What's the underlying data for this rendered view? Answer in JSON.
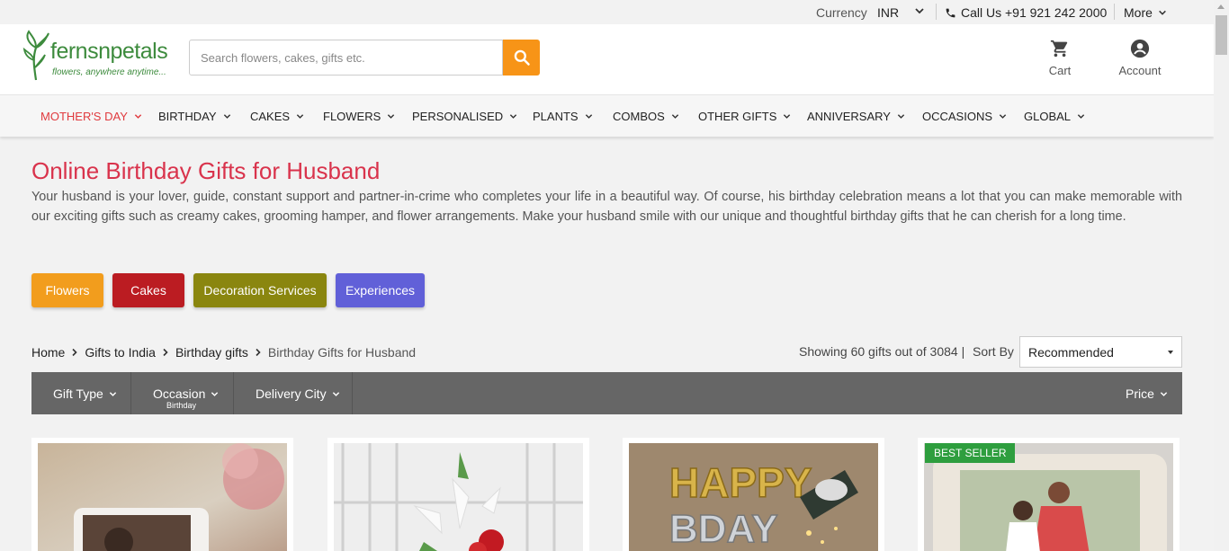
{
  "topbar": {
    "currency_label": "Currency",
    "currency_value": "INR",
    "phone": "Call Us +91 921 242 2000",
    "more": "More"
  },
  "header": {
    "logo_text": "fernsnpetals",
    "logo_tagline": "flowers, anywhere anytime...",
    "search_placeholder": "Search flowers, cakes, gifts etc.",
    "cart_label": "Cart",
    "account_label": "Account"
  },
  "nav": {
    "items": [
      {
        "label": "MOTHER'S DAY",
        "active": true
      },
      {
        "label": "BIRTHDAY"
      },
      {
        "label": "CAKES"
      },
      {
        "label": "FLOWERS"
      },
      {
        "label": "PERSONALISED"
      },
      {
        "label": "PLANTS"
      },
      {
        "label": "COMBOS"
      },
      {
        "label": "OTHER GIFTS"
      },
      {
        "label": "ANNIVERSARY"
      },
      {
        "label": "OCCASIONS"
      },
      {
        "label": "GLOBAL"
      }
    ]
  },
  "page": {
    "title": "Online Birthday Gifts for Husband",
    "description": "Your husband is your lover, guide, constant support and partner-in-crime who completes your life in a beautiful way. Of course, his birthday celebration means a lot that you can make memorable with our exciting gifts such as creamy cakes, grooming hamper, and flower arrangements. Make your husband smile with our unique and thoughtful birthday gifts that he can cherish for a long time."
  },
  "categories": [
    {
      "label": "Flowers",
      "color": "#f29d1d"
    },
    {
      "label": "Cakes",
      "color": "#bb1c22"
    },
    {
      "label": "Decoration Services",
      "color": "#8a860f"
    },
    {
      "label": "Experiences",
      "color": "#6160d8"
    }
  ],
  "breadcrumb": {
    "home": "Home",
    "gifts_to_india": "Gifts to India",
    "birthday_gifts": "Birthday gifts",
    "current": "Birthday Gifts for Husband"
  },
  "listing": {
    "showing": "Showing 60 gifts out of 3084 |",
    "sort_label": "Sort By",
    "sort_value": "Recommended"
  },
  "filters": {
    "gift_type": "Gift Type",
    "occasion": "Occasion",
    "occasion_selected": "Birthday",
    "delivery_city": "Delivery City",
    "price": "Price"
  },
  "products": {
    "badge": "BEST SELLER",
    "balloon_line1": "HAPPY",
    "balloon_line2": "BDAY"
  },
  "colors": {
    "accent_orange": "#f79417",
    "title_red": "#d9334c",
    "nav_active": "#e03a3e",
    "brand_green": "#3d8b3d",
    "filter_bar": "#666666"
  }
}
